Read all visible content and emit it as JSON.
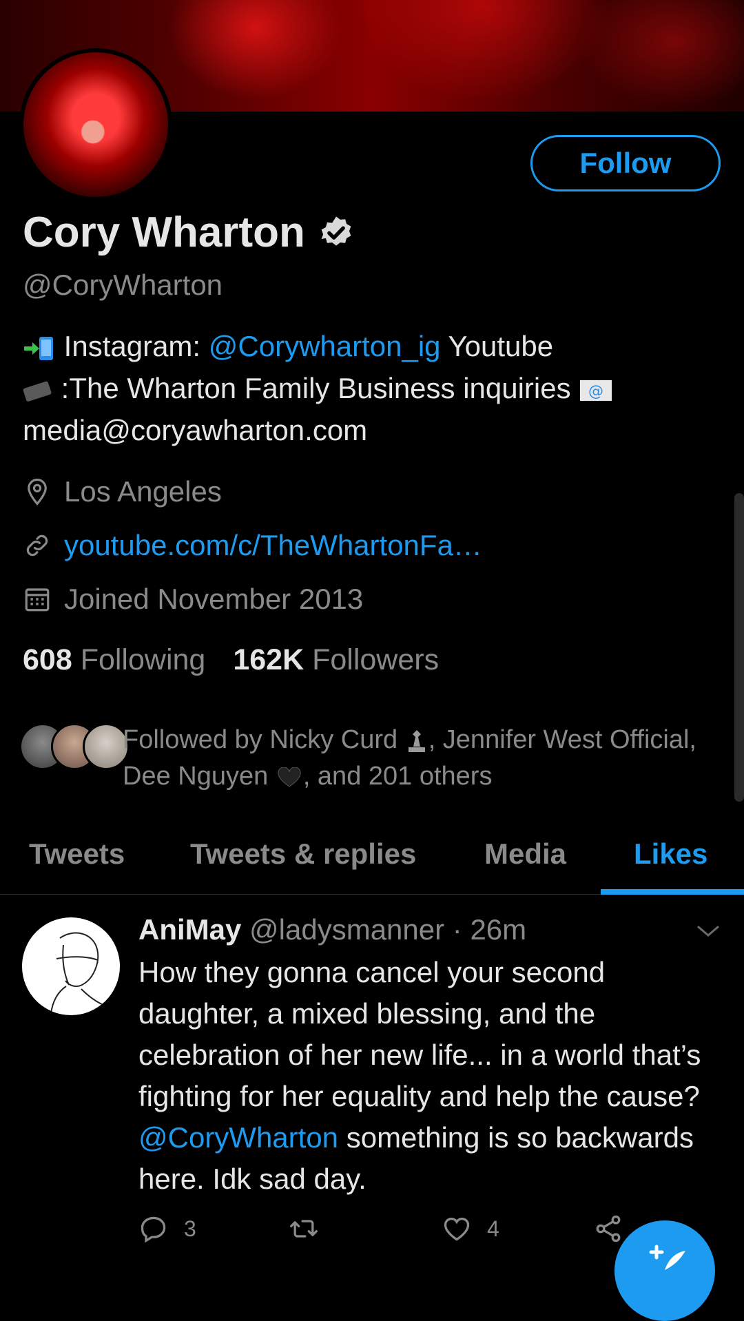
{
  "profile": {
    "follow_label": "Follow",
    "name": "Cory Wharton",
    "handle": "@CoryWharton",
    "bio_part1": " Instagram: ",
    "bio_link": "@Corywharton_ig",
    "bio_part2": " Youtube",
    "bio_part3": " :The Wharton Family Business inquiries ",
    "bio_part4": "media@coryawharton.com",
    "location": "Los Angeles",
    "website": "youtube.com/c/TheWhartonFa…",
    "joined": "Joined November 2013",
    "following_count": "608",
    "following_label": "Following",
    "followers_count": "162K",
    "followers_label": "Followers",
    "followed_by_part1": "Followed by Nicky Curd ",
    "followed_by_part2": ", Jennifer West Official, Dee Nguyen ",
    "followed_by_part3": ", and 201 others"
  },
  "tabs": [
    {
      "label": "Tweets"
    },
    {
      "label": "Tweets & replies"
    },
    {
      "label": "Media"
    },
    {
      "label": "Likes"
    }
  ],
  "tweet": {
    "name": "AniMay",
    "handle": "@ladysmanner",
    "time": "· 26m",
    "text_part1": "How they gonna cancel your second daughter, a mixed blessing, and the celebration of her new life... in a world that’s fighting for her equality and help the cause? ",
    "mention": "@CoryWharton",
    "text_part2": " something is so backwards here. Idk sad day.",
    "replies": "3",
    "likes": "4"
  },
  "colors": {
    "accent": "#1d9bf0",
    "background": "#000000",
    "secondary_text": "#8a8a8a"
  },
  "icons": [
    "verified-icon",
    "location-icon",
    "link-icon",
    "calendar-icon",
    "reply-icon",
    "retweet-icon",
    "like-icon",
    "share-icon",
    "compose-icon",
    "chevron-down-icon"
  ]
}
